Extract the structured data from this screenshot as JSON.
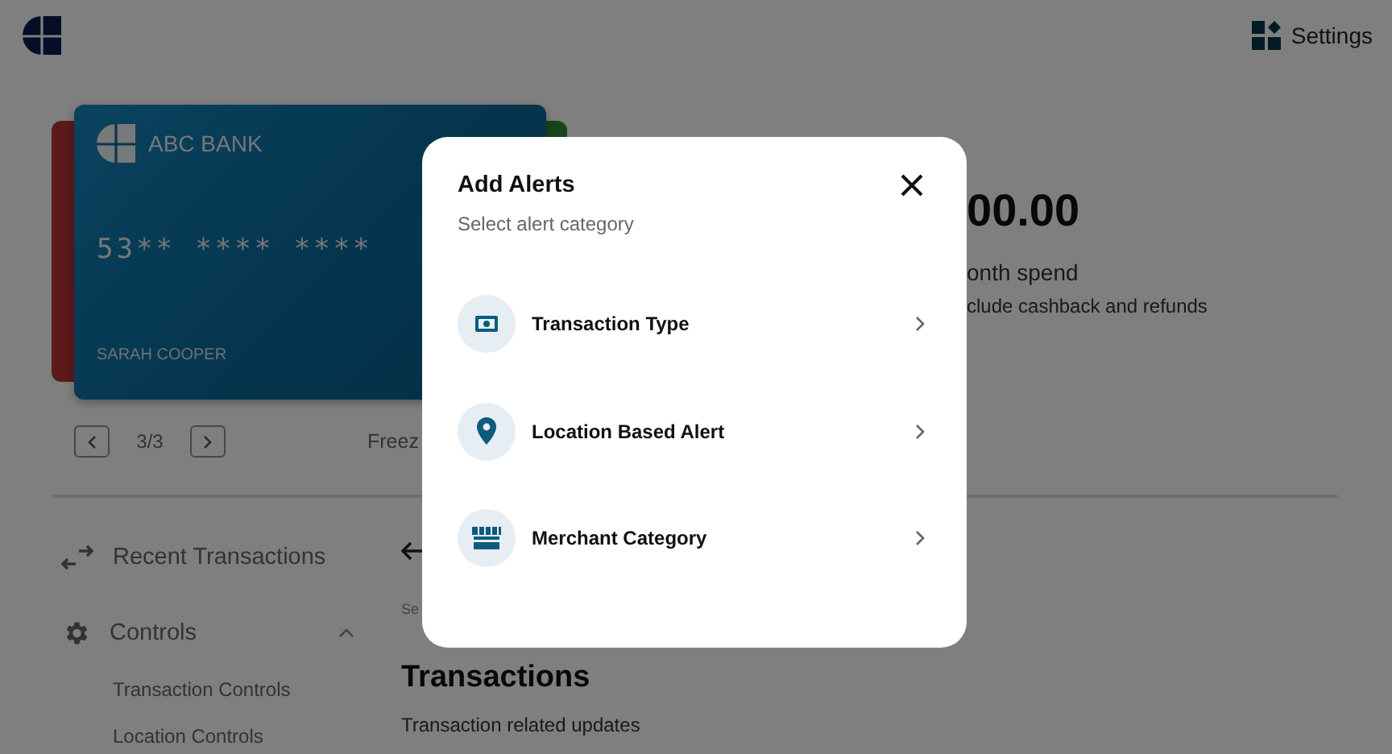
{
  "header": {
    "settings_label": "Settings"
  },
  "cards": {
    "bank_name": "ABC BANK",
    "number": "53** **** ****",
    "holder": "SARAH COOPER",
    "pager": "3/3",
    "freeze_label": "Freez"
  },
  "summary": {
    "amount": "00.00",
    "spend_label": "onth spend",
    "note": "clude cashback and refunds"
  },
  "sidebar": {
    "items": [
      {
        "label": "Recent Transactions",
        "kind": "link"
      },
      {
        "label": "Controls",
        "kind": "group",
        "expanded": true,
        "children": [
          {
            "label": "Transaction Controls"
          },
          {
            "label": "Location Controls"
          }
        ]
      }
    ]
  },
  "main": {
    "breadcrumb": "Se",
    "title": "Transactions",
    "subtitle": "Transaction related updates"
  },
  "modal": {
    "title": "Add Alerts",
    "subtitle": "Select alert category",
    "options": [
      {
        "label": "Transaction Type",
        "kind": "cash"
      },
      {
        "label": "Location Based Alert",
        "kind": "pin"
      },
      {
        "label": "Merchant Category",
        "kind": "store"
      }
    ]
  }
}
